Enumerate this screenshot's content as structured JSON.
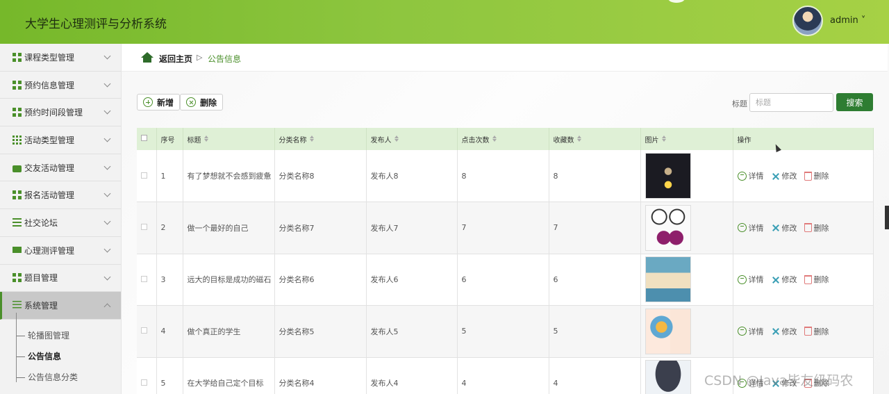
{
  "header": {
    "title": "大学生心理测评与分析系统",
    "user": "admin ˅"
  },
  "sidebar": {
    "items": [
      {
        "label": "课程类型管理",
        "icon": "grid-icon"
      },
      {
        "label": "预约信息管理",
        "icon": "grid-icon"
      },
      {
        "label": "预约时间段管理",
        "icon": "grid-icon"
      },
      {
        "label": "活动类型管理",
        "icon": "grid9-icon"
      },
      {
        "label": "交友活动管理",
        "icon": "wallet-icon"
      },
      {
        "label": "报名活动管理",
        "icon": "grid-icon"
      },
      {
        "label": "社交论坛",
        "icon": "lines-icon"
      },
      {
        "label": "心理测评管理",
        "icon": "monitor-icon"
      },
      {
        "label": "题目管理",
        "icon": "grid-icon"
      },
      {
        "label": "系统管理",
        "icon": "sliders-icon"
      }
    ],
    "subitems": [
      "轮播图管理",
      "公告信息",
      "公告信息分类"
    ]
  },
  "breadcrumb": {
    "home": "返回主页",
    "sep": "▷",
    "current": "公告信息"
  },
  "toolbar": {
    "add_label": "新增",
    "delete_label": "删除"
  },
  "search": {
    "label": "标题",
    "placeholder": "标题",
    "button": "搜索"
  },
  "table": {
    "headers": [
      "序号",
      "标题",
      "分类名称",
      "发布人",
      "点击次数",
      "收藏数",
      "图片",
      "操作"
    ],
    "rows": [
      {
        "no": "1",
        "title": "有了梦想就不会感到疲惫",
        "category": "分类名称8",
        "publisher": "发布人8",
        "clicks": "8",
        "favorites": "8"
      },
      {
        "no": "2",
        "title": "做一个最好的自己",
        "category": "分类名称7",
        "publisher": "发布人7",
        "clicks": "7",
        "favorites": "7"
      },
      {
        "no": "3",
        "title": "远大的目标是成功的磁石",
        "category": "分类名称6",
        "publisher": "发布人6",
        "clicks": "6",
        "favorites": "6"
      },
      {
        "no": "4",
        "title": "做个真正的学生",
        "category": "分类名称5",
        "publisher": "发布人5",
        "clicks": "5",
        "favorites": "5"
      },
      {
        "no": "5",
        "title": "在大学给自己定个目标",
        "category": "分类名称4",
        "publisher": "发布人4",
        "clicks": "4",
        "favorites": "4"
      }
    ],
    "actions": {
      "detail": "详情",
      "edit": "修改",
      "delete": "删除"
    }
  },
  "watermark": "CSDN @Java毕友级码农"
}
